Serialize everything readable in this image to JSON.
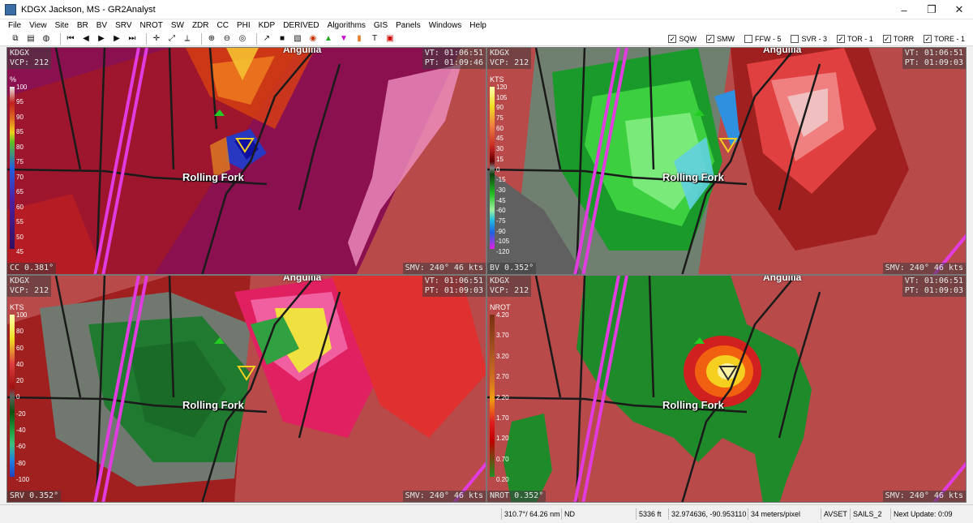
{
  "window": {
    "title": "KDGX Jackson, MS - GR2Analyst"
  },
  "menu": [
    "File",
    "View",
    "Site",
    "BR",
    "BV",
    "SRV",
    "NROT",
    "SW",
    "ZDR",
    "CC",
    "PHI",
    "KDP",
    "DERIVED",
    "Algorithms",
    "GIS",
    "Panels",
    "Windows",
    "Help"
  ],
  "warnings": [
    {
      "label": "SQW",
      "checked": true
    },
    {
      "label": "SMW",
      "checked": true
    },
    {
      "label": "FFW - 5",
      "checked": false
    },
    {
      "label": "SVR - 3",
      "checked": false
    },
    {
      "label": "TOR - 1",
      "checked": true
    },
    {
      "label": "TORR",
      "checked": true
    },
    {
      "label": "TORE - 1",
      "checked": true
    }
  ],
  "map": {
    "city": "Rolling Fork",
    "top_city": "Anguilla"
  },
  "panels": {
    "tl": {
      "site": "KDGX",
      "vcp": "VCP: 212",
      "vt": "VT: 01:06:51",
      "pt": "PT: 01:09:46",
      "product": "CC 0.381°",
      "smv": "SMV: 240° 46 kts",
      "legend_unit": "%",
      "legend": [
        "100",
        "95",
        "90",
        "85",
        "80",
        "75",
        "70",
        "65",
        "60",
        "55",
        "50",
        "45"
      ]
    },
    "tr": {
      "site": "KDGX",
      "vcp": "VCP: 212",
      "vt": "VT: 01:06:51",
      "pt": "PT: 01:09:03",
      "product": "BV 0.352°",
      "smv": "SMV: 240° 46 kts",
      "legend_unit": "KTS",
      "legend": [
        "120",
        "105",
        "90",
        "75",
        "60",
        "45",
        "30",
        "15",
        "0",
        "-15",
        "-30",
        "-45",
        "-60",
        "-75",
        "-90",
        "-105",
        "-120"
      ]
    },
    "bl": {
      "site": "KDGX",
      "vcp": "VCP: 212",
      "vt": "VT: 01:06:51",
      "pt": "PT: 01:09:03",
      "product": "SRV 0.352°",
      "smv": "SMV: 240° 46 kts",
      "legend_unit": "KTS",
      "legend": [
        "100",
        "80",
        "60",
        "40",
        "20",
        "0",
        "-20",
        "-40",
        "-60",
        "-80",
        "-100"
      ]
    },
    "br": {
      "site": "KDGX",
      "vcp": "VCP: 212",
      "vt": "VT: 01:06:51",
      "pt": "PT: 01:09:03",
      "product": "NROT 0.352°",
      "smv": "SMV: 240° 46 kts",
      "legend_unit": "NROT",
      "legend": [
        "4.20",
        "3.70",
        "3.20",
        "2.70",
        "2.20",
        "1.70",
        "1.20",
        "0.70",
        "0.20"
      ]
    }
  },
  "status": {
    "azimuth": "310.7°/ 64.26 nm",
    "value": "ND",
    "height": "5336 ft",
    "coords": "32.974636, -90.953110",
    "resolution": "34 meters/pixel",
    "avset": "AVSET",
    "sails": "SAILS_2",
    "next_update": "Next Update: 0:09"
  },
  "colors": {
    "cc_bg": "#8a1050",
    "bv_bg": "#b23c3c",
    "highway": "#e23be0",
    "road": "#1a1a1a"
  }
}
